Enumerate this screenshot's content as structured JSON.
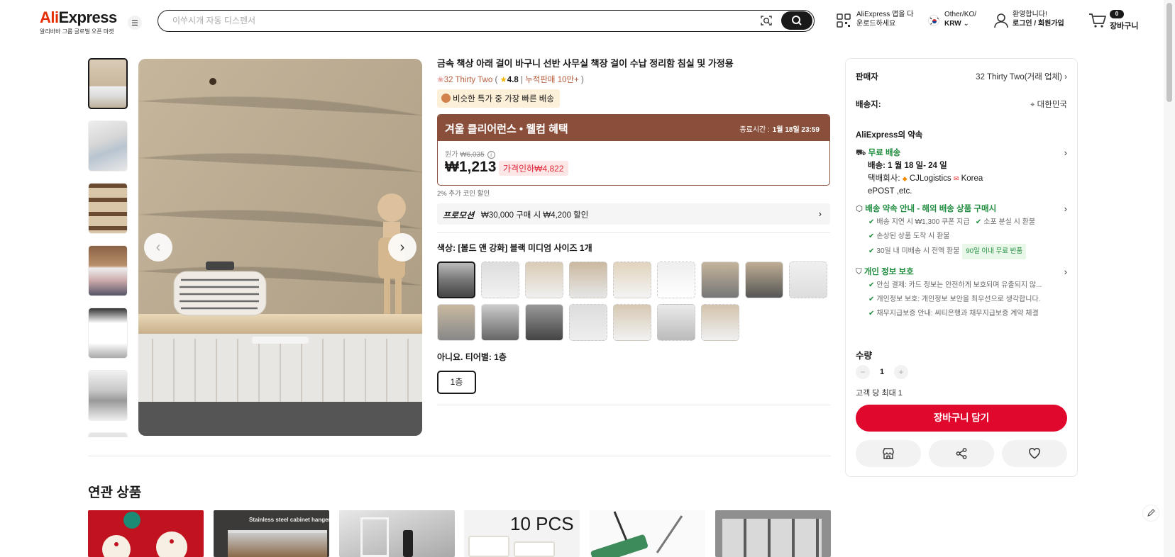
{
  "header": {
    "logo_text": "AliExpress",
    "logo_sub": "알리바바 그룹 글로벌 오픈 마켓",
    "search_placeholder": "이쑤시개 자동 디스펜서",
    "app_download_line1": "AliExpress 앱을 다",
    "app_download_line2": "운로드하세요",
    "lang_line1": "Other/KO/",
    "lang_line2": "KRW",
    "user_line1": "환영합니다!",
    "user_line2": "로그인 / 회원가입",
    "cart_count": "0",
    "cart_label": "장바구니"
  },
  "product": {
    "title": "금속 책상 아래 걸이 바구니 선반 사무실 책장 걸이 수납 정리함 침실 및 가정용",
    "store_name": "32 Thirty Two",
    "rating": "4.8",
    "sold": "누적판매 10만+",
    "fast_badge": "비슷한 특가 중 가장 빠른 배송",
    "deal_title": "겨울 클리어런스 • 웰컴 혜택",
    "deal_end_label": "종료시간 :",
    "deal_end_value": "1월 18일 23:59",
    "orig_label": "원가",
    "orig_price": "₩6,035",
    "price": "₩1,213",
    "discount": "가격인하₩4,822",
    "coin": "2% 추가 코인 할인",
    "promo_label": "프로모션",
    "promo_desc": "₩30,000 구매 시 ₩4,200 할인",
    "color_label": "색상: [볼드 앤 강화] 블랙 미디엄 사이즈 1개",
    "tier_label": "아니요. 티어별: 1층",
    "tier_option": "1층"
  },
  "panel": {
    "seller_label": "판매자",
    "seller_value": "32 Thirty Two(거래 업체)",
    "ship_to_label": "배송지:",
    "ship_to_value": "대한민국",
    "promise_title": "AliExpress의 약속",
    "free_shipping": "무료 배송",
    "delivery": "배송: 1 월 18 일- 24 일",
    "carrier_label": "택배회사:",
    "carrier_1": "CJLogistics",
    "carrier_2": "Korea",
    "carrier_3": "ePOST ,etc.",
    "guide_title": "배송 약속 안내 - 해외 배송 상품 구매시",
    "guide_1a": "배송 지연 시 ₩1,300 쿠폰 지급",
    "guide_1b": "소포 분실 시 환불",
    "guide_2": "손상된 상품 도착 시 환불",
    "guide_3": "30일 내 미배송 시 전액 환불",
    "guide_3_tag": "90일 이내 무료 반품",
    "privacy_title": "개인 정보 보호",
    "privacy_1": "안심 결제: 카드 정보는 안전하게 보호되며 유출되지 않...",
    "privacy_2": "개인정보 보호: 개인정보 보안을 최우선으로 생각합니다.",
    "privacy_3": "채무지급보증 안내: 씨티은행과 채무지급보증 계약 체결",
    "qty_label": "수량",
    "qty_value": "1",
    "limit": "고객 당 최대 1",
    "add_to_cart": "장바구니 담기"
  },
  "related": {
    "title": "연관 상품",
    "item2_text": "Stainless steel cabinet hanger",
    "item4_text": "10 PCS"
  },
  "colors": {
    "brand_red": "#e0082d",
    "deal_brown": "#8a4f3b",
    "success_green": "#1f8c3e"
  },
  "icons": [
    "hamburger-icon",
    "camera-icon",
    "search-icon",
    "qr-icon",
    "flag-icon",
    "user-icon",
    "cart-icon",
    "truck-icon",
    "shield-icon",
    "store-icon",
    "share-icon",
    "heart-icon",
    "pin-icon",
    "edit-icon"
  ]
}
